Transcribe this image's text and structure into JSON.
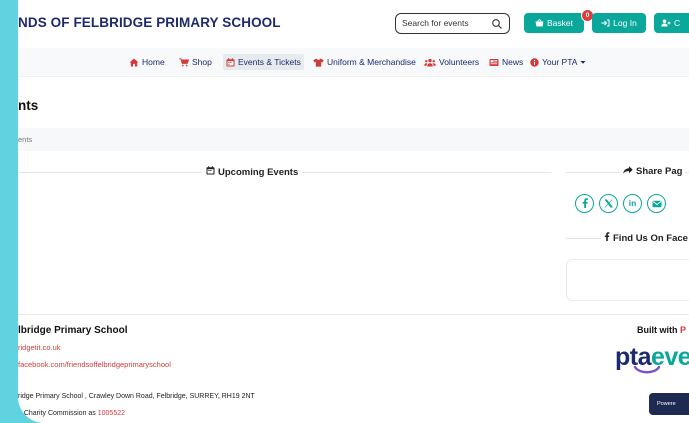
{
  "header": {
    "site_title": "NDS OF FELBRIDGE PRIMARY SCHOOL",
    "search": {
      "placeholder": "Search for events"
    },
    "basket": {
      "label": "Basket",
      "count": "0"
    },
    "login": {
      "label": "Log In"
    },
    "create": {
      "label": "C"
    }
  },
  "nav": {
    "items": [
      {
        "label": "Home",
        "icon": "home-icon"
      },
      {
        "label": "Shop",
        "icon": "cart-icon"
      },
      {
        "label": "Events & Tickets",
        "icon": "calendar-icon",
        "active": true
      },
      {
        "label": "Uniform & Merchandise",
        "icon": "tshirt-icon"
      },
      {
        "label": "Volunteers",
        "icon": "users-icon"
      },
      {
        "label": "News",
        "icon": "newspaper-icon"
      },
      {
        "label": "Your PTA",
        "icon": "info-icon",
        "dropdown": true
      }
    ]
  },
  "page": {
    "heading": "nts",
    "breadcrumb": "ents",
    "upcoming_title": "Upcoming Events"
  },
  "sidebar": {
    "share_title": "Share Pag",
    "social": [
      "facebook-icon",
      "x-icon",
      "linkedin-icon",
      "email-icon"
    ],
    "facebook_title": "Find Us On Face"
  },
  "footer": {
    "org_name": "lbridge Primary School",
    "website": "ridgetit.co.uk",
    "facebook": "facebook.com/friendsoffelbridgeprimaryschool",
    "address": "ridge Primary School , Crawley Down Road, Felbridge, SURREY, RH19 2NT",
    "charity_prefix": "e Charity Commission as ",
    "charity_number": "1005522",
    "built_prefix": "Built with ",
    "built_suffix": "P",
    "logo_a": "pta",
    "logo_b": "eve",
    "powered": "Powere"
  },
  "colors": {
    "accent": "#0aa89b",
    "navy": "#1d2a6b",
    "red": "#d33b3b",
    "backdrop": "#5fd3df"
  }
}
